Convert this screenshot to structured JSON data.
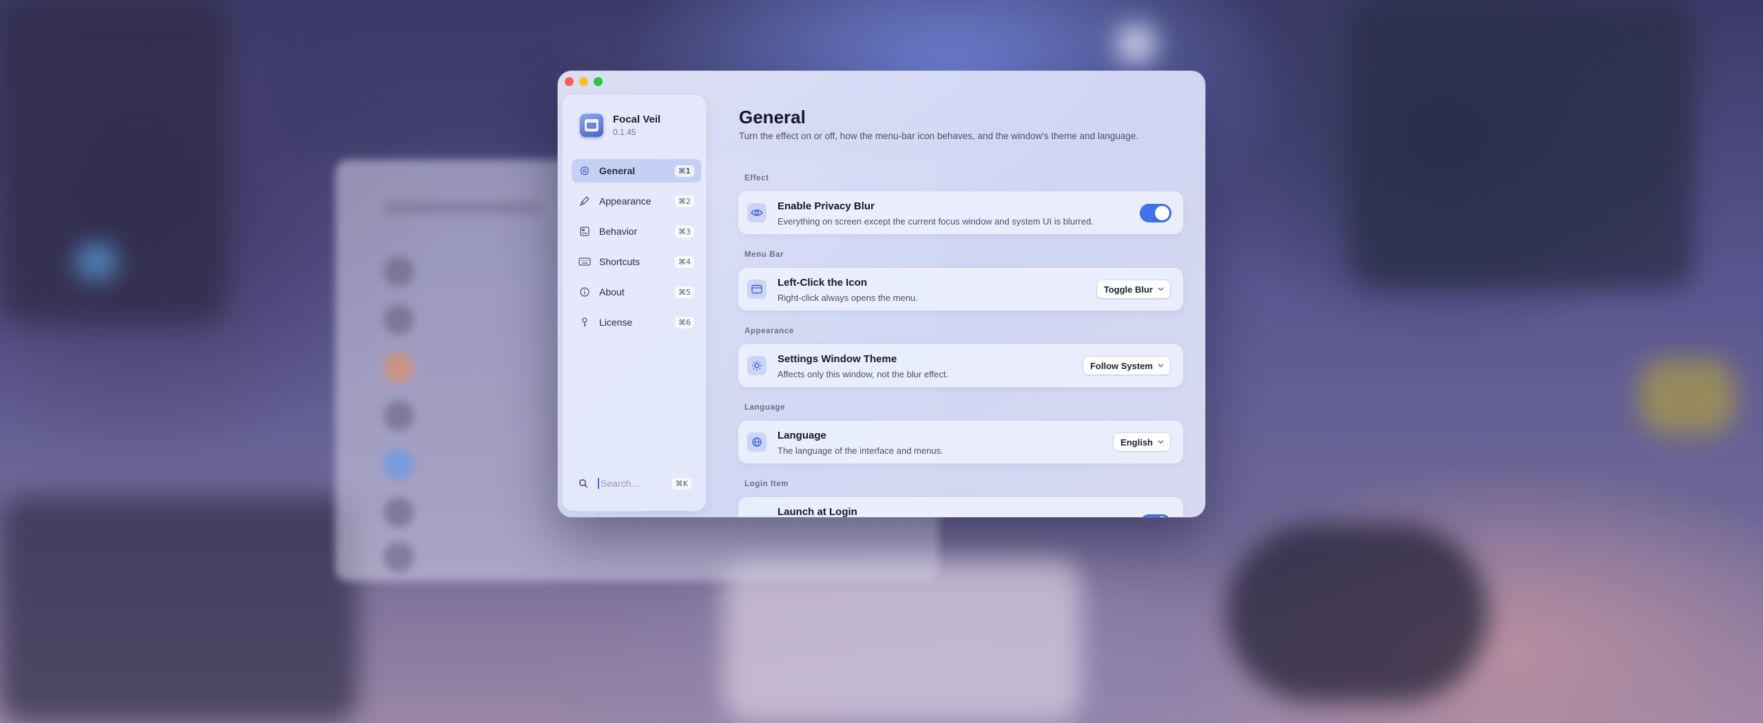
{
  "app": {
    "name": "Focal Veil",
    "version": "0.1.45"
  },
  "colors": {
    "accent": "#3e72ef",
    "close": "#ff5f57",
    "minimize": "#febc2e",
    "zoom": "#28c840"
  },
  "sidebar": {
    "items": [
      {
        "label": "General",
        "shortcut": "⌘1",
        "icon": "gear-icon",
        "active": true
      },
      {
        "label": "Appearance",
        "shortcut": "⌘2",
        "icon": "brush-icon"
      },
      {
        "label": "Behavior",
        "shortcut": "⌘3",
        "icon": "sliders-icon"
      },
      {
        "label": "Shortcuts",
        "shortcut": "⌘4",
        "icon": "keyboard-icon"
      },
      {
        "label": "About",
        "shortcut": "⌘5",
        "icon": "info-icon"
      },
      {
        "label": "License",
        "shortcut": "⌘6",
        "icon": "key-icon"
      }
    ],
    "search": {
      "placeholder": "Search...",
      "shortcut": "⌘K"
    }
  },
  "page": {
    "title": "General",
    "subtitle": "Turn the effect on or off, how the menu-bar icon behaves, and the window's theme and language."
  },
  "sections": {
    "effect": {
      "label": "Effect",
      "title": "Enable Privacy Blur",
      "description": "Everything on screen except the current focus window and system UI is blurred.",
      "enabled": true
    },
    "menu_bar": {
      "label": "Menu Bar",
      "title": "Left-Click the Icon",
      "description": "Right-click always opens the menu.",
      "value": "Toggle Blur"
    },
    "appearance": {
      "label": "Appearance",
      "title": "Settings Window Theme",
      "description": "Affects only this window, not the blur effect.",
      "value": "Follow System"
    },
    "language": {
      "label": "Language",
      "title": "Language",
      "description": "The language of the interface and menus.",
      "value": "English"
    },
    "login_item": {
      "label": "Login Item",
      "title": "Launch at Login"
    }
  }
}
